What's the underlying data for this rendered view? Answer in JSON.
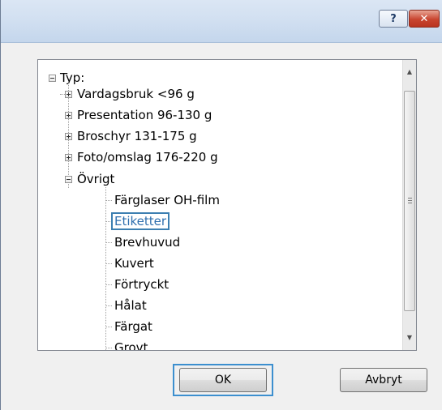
{
  "titlebar": {
    "help_icon": "help-icon",
    "help_glyph": "?",
    "close_icon": "close-icon",
    "close_glyph": "✕"
  },
  "tree": {
    "root": {
      "label": "Typ:",
      "expanded": true
    },
    "groups": [
      {
        "label": "Vardagsbruk <96 g",
        "expanded": false
      },
      {
        "label": "Presentation 96-130 g",
        "expanded": false
      },
      {
        "label": "Broschyr 131-175 g",
        "expanded": false
      },
      {
        "label": "Foto/omslag 176-220 g",
        "expanded": false
      },
      {
        "label": "Övrigt",
        "expanded": true
      }
    ],
    "other_items": [
      {
        "label": "Färglaser OH-film",
        "selected": false
      },
      {
        "label": "Etiketter",
        "selected": true
      },
      {
        "label": "Brevhuvud",
        "selected": false
      },
      {
        "label": "Kuvert",
        "selected": false
      },
      {
        "label": "Förtryckt",
        "selected": false
      },
      {
        "label": "Hålat",
        "selected": false
      },
      {
        "label": "Färgat",
        "selected": false
      },
      {
        "label": "Grovt",
        "selected": false
      }
    ]
  },
  "scrollbar": {
    "up_glyph": "▲",
    "down_glyph": "▼"
  },
  "buttons": {
    "ok": "OK",
    "cancel": "Avbryt"
  },
  "colors": {
    "selection_outline": "#3c7fb1",
    "focus_ring": "#3c8fcf",
    "close_button": "#c9452f"
  }
}
